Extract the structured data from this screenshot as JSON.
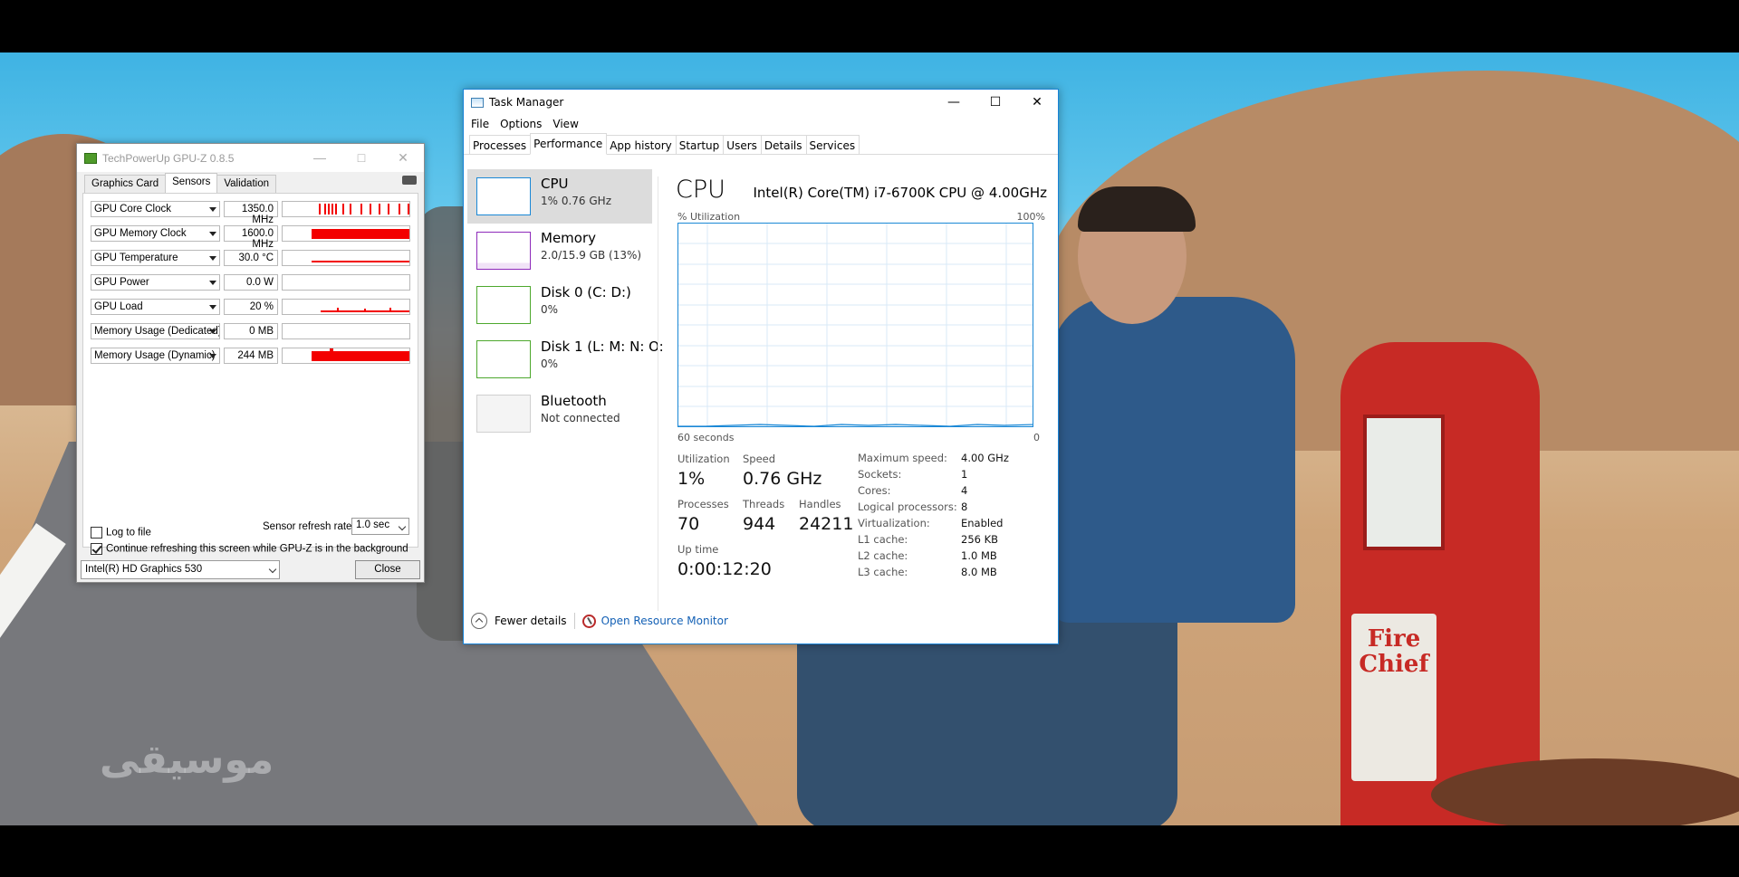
{
  "desktop": {
    "wallpaper_watermark": "موسیقی",
    "pump_sign": "Fire Chief"
  },
  "gpuz": {
    "title": "TechPowerUp GPU-Z 0.8.5",
    "tabs": [
      "Graphics Card",
      "Sensors",
      "Validation"
    ],
    "active_tab": "Sensors",
    "sensors": [
      {
        "name": "GPU Core Clock",
        "value": "1350.0 MHz"
      },
      {
        "name": "GPU Memory Clock",
        "value": "1600.0 MHz"
      },
      {
        "name": "GPU Temperature",
        "value": "30.0 °C"
      },
      {
        "name": "GPU Power",
        "value": "0.0 W"
      },
      {
        "name": "GPU Load",
        "value": "20 %"
      },
      {
        "name": "Memory Usage (Dedicated)",
        "value": "0 MB"
      },
      {
        "name": "Memory Usage (Dynamic)",
        "value": "244 MB"
      }
    ],
    "log_to_file": "Log to file",
    "refresh_label": "Sensor refresh rate:",
    "refresh_value": "1.0 sec",
    "continue_refresh": "Continue refreshing this screen while GPU-Z is in the background",
    "gpu_select": "Intel(R) HD Graphics 530",
    "close_label": "Close",
    "colors": {
      "graph": "#f30000"
    }
  },
  "taskmanager": {
    "title": "Task Manager",
    "menu": [
      "File",
      "Options",
      "View"
    ],
    "tabs": [
      "Processes",
      "Performance",
      "App history",
      "Startup",
      "Users",
      "Details",
      "Services"
    ],
    "active_tab": "Performance",
    "sidebar": [
      {
        "name": "CPU",
        "sub": "1% 0.76 GHz",
        "color": "#1a88d6"
      },
      {
        "name": "Memory",
        "sub": "2.0/15.9 GB (13%)",
        "color": "#8e2bba"
      },
      {
        "name": "Disk 0 (C: D:)",
        "sub": "0%",
        "color": "#4da82d"
      },
      {
        "name": "Disk 1 (L: M: N: O:",
        "sub": "0%",
        "color": "#4da82d"
      },
      {
        "name": "Bluetooth",
        "sub": "Not connected",
        "color": "#bbbbbb"
      }
    ],
    "cpu": {
      "heading": "CPU",
      "model": "Intel(R) Core(TM) i7-6700K CPU @ 4.00GHz",
      "util_label": "% Utilization",
      "util_max": "100%",
      "time_left": "60 seconds",
      "time_right": "0",
      "stats": {
        "utilization_label": "Utilization",
        "utilization": "1%",
        "speed_label": "Speed",
        "speed": "0.76 GHz",
        "processes_label": "Processes",
        "processes": "70",
        "threads_label": "Threads",
        "threads": "944",
        "handles_label": "Handles",
        "handles": "24211",
        "uptime_label": "Up time",
        "uptime": "0:00:12:20"
      },
      "specs": [
        {
          "key": "Maximum speed:",
          "val": "4.00 GHz"
        },
        {
          "key": "Sockets:",
          "val": "1"
        },
        {
          "key": "Cores:",
          "val": "4"
        },
        {
          "key": "Logical processors:",
          "val": "8"
        },
        {
          "key": "Virtualization:",
          "val": "Enabled"
        },
        {
          "key": "L1 cache:",
          "val": "256 KB"
        },
        {
          "key": "L2 cache:",
          "val": "1.0 MB"
        },
        {
          "key": "L3 cache:",
          "val": "8.0 MB"
        }
      ],
      "colors": {
        "line": "#1a88d6",
        "grid": "#d9eaf7"
      }
    },
    "footer": {
      "fewer_details": "Fewer details",
      "resource_monitor": "Open Resource Monitor"
    }
  }
}
